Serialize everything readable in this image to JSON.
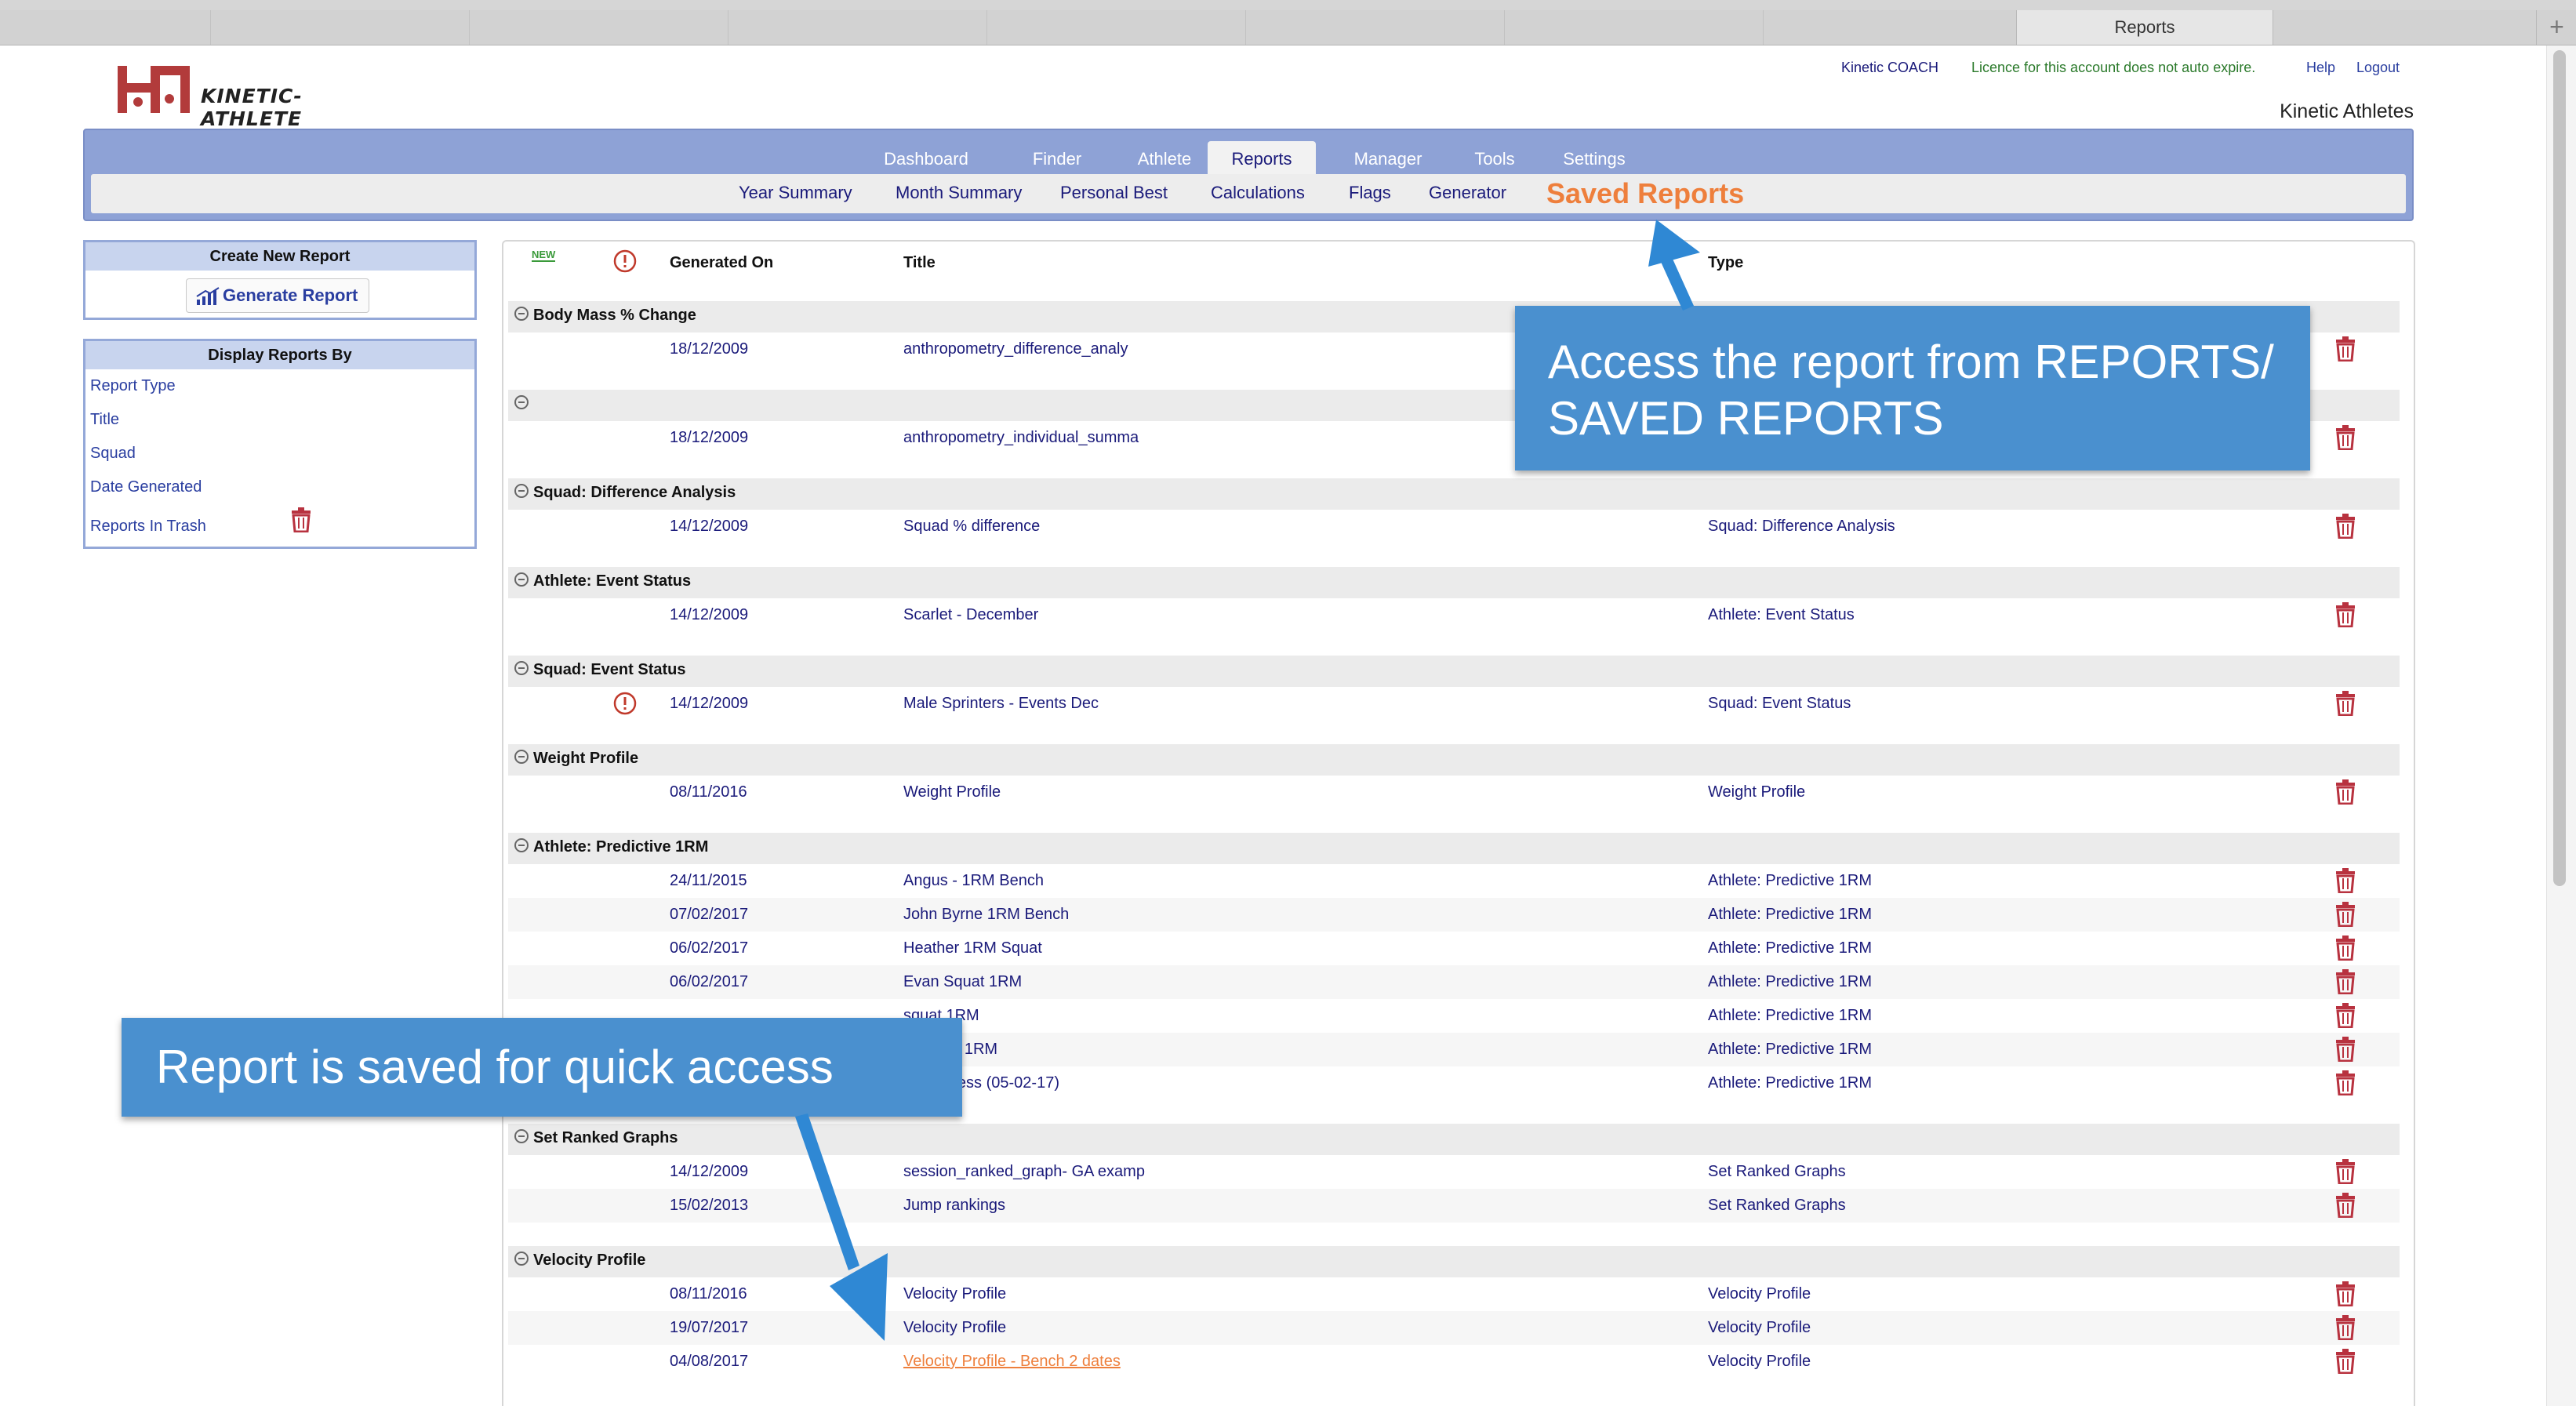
{
  "browser": {
    "tab_title": "Reports"
  },
  "header": {
    "logo_text": "KINETIC-ATHLETE",
    "user": "Kinetic COACH",
    "licence": "Licence for this account does not auto expire.",
    "help": "Help",
    "logout": "Logout",
    "account": "Kinetic Athletes"
  },
  "nav": {
    "main": [
      "Dashboard",
      "Finder",
      "Athlete",
      "Reports",
      "Manager",
      "Tools",
      "Settings"
    ],
    "active_main": "Reports",
    "sub": [
      "Year Summary",
      "Month Summary",
      "Personal Best",
      "Calculations",
      "Flags",
      "Generator",
      "Saved Reports"
    ],
    "active_sub": "Saved Reports"
  },
  "sidebar": {
    "create_title": "Create New Report",
    "generate_button": "Generate Report",
    "display_title": "Display Reports By",
    "items": [
      "Report Type",
      "Title",
      "Squad",
      "Date Generated",
      "Reports In Trash"
    ]
  },
  "table": {
    "new_badge": "NEW",
    "columns": {
      "generated": "Generated On",
      "title": "Title",
      "type": "Type"
    },
    "groups": [
      {
        "name": "Body Mass % Change",
        "rows": [
          {
            "date": "18/12/2009",
            "title": "anthropometry_difference_analy",
            "type": ""
          }
        ]
      },
      {
        "name": "",
        "rows": [
          {
            "date": "18/12/2009",
            "title": "anthropometry_individual_summa",
            "type": ""
          }
        ]
      },
      {
        "name": "Squad: Difference Analysis",
        "rows": [
          {
            "date": "14/12/2009",
            "title": "Squad % difference",
            "type": "Squad: Difference Analysis"
          }
        ]
      },
      {
        "name": "Athlete: Event Status",
        "rows": [
          {
            "date": "14/12/2009",
            "title": "Scarlet - December",
            "type": "Athlete: Event Status"
          }
        ]
      },
      {
        "name": "Squad: Event Status",
        "rows": [
          {
            "date": "14/12/2009",
            "title": "Male Sprinters - Events Dec",
            "type": "Squad: Event Status",
            "warning": true
          }
        ]
      },
      {
        "name": "Weight Profile",
        "rows": [
          {
            "date": "08/11/2016",
            "title": "Weight Profile",
            "type": "Weight Profile"
          }
        ]
      },
      {
        "name": "Athlete: Predictive 1RM",
        "rows": [
          {
            "date": "24/11/2015",
            "title": "Angus - 1RM Bench",
            "type": "Athlete: Predictive 1RM"
          },
          {
            "date": "07/02/2017",
            "title": "John Byrne 1RM Bench",
            "type": "Athlete: Predictive 1RM"
          },
          {
            "date": "06/02/2017",
            "title": "Heather 1RM Squat",
            "type": "Athlete: Predictive 1RM"
          },
          {
            "date": "06/02/2017",
            "title": "Evan Squat 1RM",
            "type": "Athlete: Predictive 1RM"
          },
          {
            "date": "",
            "title": "squat 1RM",
            "type": "Athlete: Predictive 1RM"
          },
          {
            "date": "",
            "title": "s Bench 1RM",
            "type": "Athlete: Predictive 1RM"
          },
          {
            "date": "",
            "title": "ench Press (05-02-17)",
            "type": "Athlete: Predictive 1RM"
          }
        ]
      },
      {
        "name": "Set Ranked Graphs",
        "rows": [
          {
            "date": "14/12/2009",
            "title": "session_ranked_graph- GA examp",
            "type": "Set Ranked Graphs"
          },
          {
            "date": "15/02/2013",
            "title": "Jump rankings",
            "type": "Set Ranked Graphs"
          }
        ]
      },
      {
        "name": "Velocity Profile",
        "rows": [
          {
            "date": "08/11/2016",
            "title": "Velocity Profile",
            "type": "Velocity Profile"
          },
          {
            "date": "19/07/2017",
            "title": "Velocity Profile",
            "type": "Velocity Profile"
          },
          {
            "date": "04/08/2017",
            "title": "Velocity Profile - Bench 2 dates",
            "type": "Velocity Profile",
            "highlight": true
          }
        ]
      }
    ]
  },
  "callouts": {
    "access": "Access the report from REPORTS/ SAVED REPORTS",
    "saved": "Report is saved for quick access"
  },
  "colors": {
    "nav": "#8ea2d6",
    "accent": "#ee7f3c",
    "callout": "#4a90cf",
    "text": "#1a1a7a",
    "trash": "#b8323f"
  }
}
